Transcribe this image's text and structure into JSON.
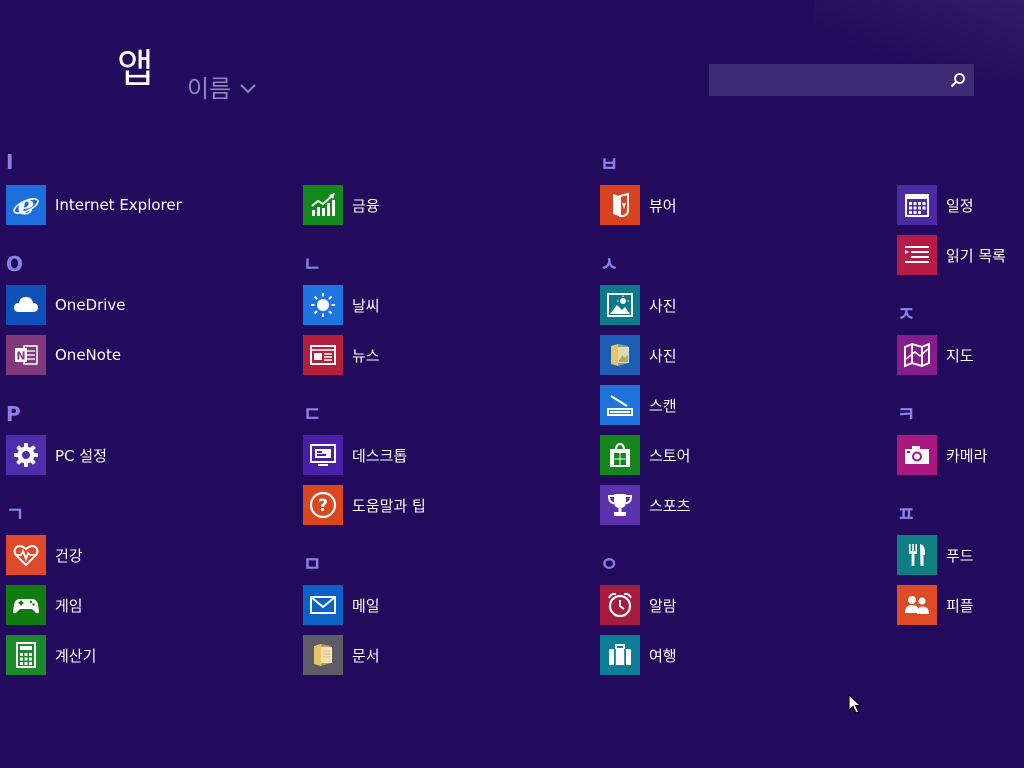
{
  "header": {
    "title": "앱",
    "sort_label": "이름",
    "search": {
      "value": "",
      "placeholder": ""
    }
  },
  "colors": {
    "background": "#220b5c",
    "letter": "#8c80e6",
    "sort_text": "#8f83c3",
    "search_box": "#3f2a76"
  },
  "groups": {
    "i": {
      "letter": "I"
    },
    "o": {
      "letter": "O"
    },
    "p": {
      "letter": "P"
    },
    "g": {
      "letter": "ㄱ"
    },
    "n": {
      "letter": "ㄴ"
    },
    "d": {
      "letter": "ㄷ"
    },
    "m": {
      "letter": "ㅁ"
    },
    "b": {
      "letter": "ㅂ"
    },
    "s": {
      "letter": "ㅅ"
    },
    "ieung": {
      "letter": "ㅇ"
    },
    "j": {
      "letter": "ㅈ"
    },
    "k": {
      "letter": "ㅋ"
    },
    "pp": {
      "letter": "ㅍ"
    }
  },
  "apps": {
    "internet_explorer": {
      "label": "Internet Explorer",
      "icon": "internet-explorer-icon",
      "color": "#1e6fde"
    },
    "onedrive": {
      "label": "OneDrive",
      "icon": "cloud-icon",
      "color": "#0f4fb8"
    },
    "onenote": {
      "label": "OneNote",
      "icon": "onenote-icon",
      "color": "#80397b"
    },
    "pc_settings": {
      "label": "PC 설정",
      "icon": "gear-icon",
      "color": "#4d2dac"
    },
    "health": {
      "label": "건강",
      "icon": "heart-pulse-icon",
      "color": "#e0482a"
    },
    "games": {
      "label": "게임",
      "icon": "gamepad-icon",
      "color": "#107c10"
    },
    "calculator": {
      "label": "계산기",
      "icon": "calculator-icon",
      "color": "#1a8a2c"
    },
    "finance": {
      "label": "금융",
      "icon": "finance-chart-icon",
      "color": "#11891c"
    },
    "weather": {
      "label": "날씨",
      "icon": "sun-icon",
      "color": "#1c75e0"
    },
    "news": {
      "label": "뉴스",
      "icon": "newspaper-icon",
      "color": "#b41f3a"
    },
    "desktop": {
      "label": "데스크톱",
      "icon": "desktop-icon",
      "color": "#4a1fa8"
    },
    "help_tips": {
      "label": "도움말과 팁",
      "icon": "question-icon",
      "color": "#d9461f"
    },
    "mail": {
      "label": "메일",
      "icon": "mail-icon",
      "color": "#0a64c8"
    },
    "documents": {
      "label": "문서",
      "icon": "folder-icon",
      "color": "#5d5c66"
    },
    "reader": {
      "label": "뷰어",
      "icon": "reader-icon",
      "color": "#d8421e"
    },
    "photos": {
      "label": "사진",
      "icon": "photo-icon",
      "color": "#0b7b8c"
    },
    "pictures": {
      "label": "사진",
      "icon": "folder-icon",
      "color": "#1d5db5"
    },
    "scan": {
      "label": "스캔",
      "icon": "scanner-icon",
      "color": "#1f74d9"
    },
    "store": {
      "label": "스토어",
      "icon": "store-bag-icon",
      "color": "#15861d"
    },
    "sports": {
      "label": "스포츠",
      "icon": "trophy-icon",
      "color": "#5b33ac"
    },
    "alarms": {
      "label": "알람",
      "icon": "alarm-clock-icon",
      "color": "#a61c3c"
    },
    "travel": {
      "label": "여행",
      "icon": "suitcase-icon",
      "color": "#0b7d96"
    },
    "calendar": {
      "label": "일정",
      "icon": "calendar-icon",
      "color": "#4c2aa4"
    },
    "reading_list": {
      "label": "읽기 목록",
      "icon": "reading-list-icon",
      "color": "#b51b45"
    },
    "maps": {
      "label": "지도",
      "icon": "map-icon",
      "color": "#851d8b"
    },
    "camera": {
      "label": "카메라",
      "icon": "camera-icon",
      "color": "#a8187f"
    },
    "food": {
      "label": "푸드",
      "icon": "fork-knife-icon",
      "color": "#0f7e83"
    },
    "people": {
      "label": "피플",
      "icon": "people-icon",
      "color": "#dc4a26"
    }
  }
}
